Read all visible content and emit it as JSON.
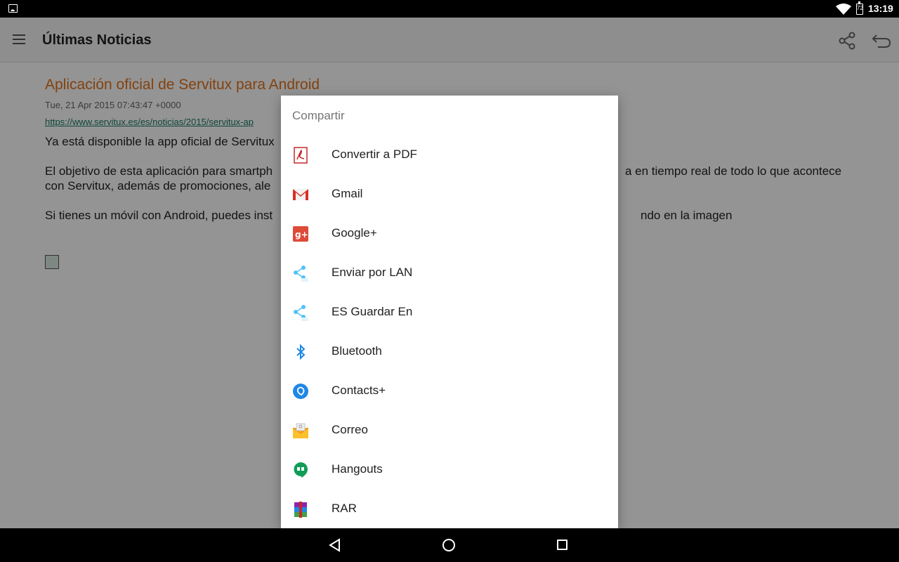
{
  "status_bar": {
    "time": "13:19",
    "battery_level": "72"
  },
  "app_bar": {
    "title": "Últimas Noticias"
  },
  "article": {
    "title": "Aplicación oficial de Servitux para Android",
    "date": "Tue, 21 Apr 2015 07:43:47 +0000",
    "link": "https://www.servitux.es/es/noticias/2015/servitux-ap",
    "paragraphs": [
      {
        "left": "Ya está disponible la app oficial de Servitux",
        "right": ""
      },
      {
        "left": "El objetivo de esta aplicación para smartph",
        "right": "a en tiempo real de todo lo que acontece",
        "left2": "con Servitux, además de promociones, ale"
      },
      {
        "left": "Si tienes un móvil con Android, puedes inst",
        "right": "ndo en la imagen"
      }
    ]
  },
  "dialog": {
    "title": "Compartir",
    "items": [
      {
        "label": "Convertir a PDF",
        "icon": "pdf-icon"
      },
      {
        "label": "Gmail",
        "icon": "gmail-icon"
      },
      {
        "label": "Google+",
        "icon": "google-plus-icon"
      },
      {
        "label": "Enviar por LAN",
        "icon": "es-share-icon"
      },
      {
        "label": "ES Guardar En",
        "icon": "es-share-icon"
      },
      {
        "label": "Bluetooth",
        "icon": "bluetooth-icon"
      },
      {
        "label": "Contacts+",
        "icon": "contacts-plus-icon"
      },
      {
        "label": "Correo",
        "icon": "mail-icon"
      },
      {
        "label": "Hangouts",
        "icon": "hangouts-icon"
      },
      {
        "label": "RAR",
        "icon": "rar-icon"
      }
    ]
  },
  "colors": {
    "article_title": "#e0731c",
    "link": "#1a7a62",
    "dialog_title": "#757575"
  }
}
